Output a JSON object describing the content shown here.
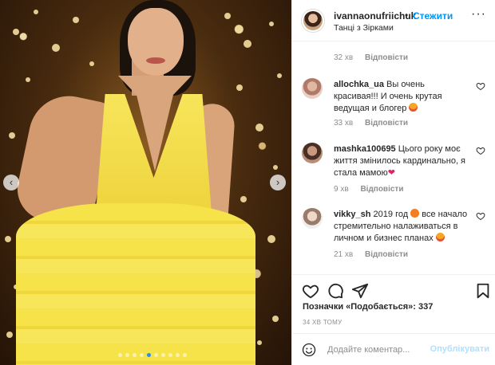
{
  "header": {
    "username": "ivannaonufriichuk",
    "separator": "•",
    "follow_label": "Стежити",
    "location": "Танці з Зірками",
    "more_icon": "more-horizontal-icon"
  },
  "comments": [
    {
      "meta_time": "32 хв",
      "reply_label": "Відповісти"
    },
    {
      "username": "allochka_ua",
      "text": "Вы очень красивая!!! И очень крутая ведущая и блогер",
      "emoji": "heart-eyes-emoji",
      "time": "33 хв",
      "reply_label": "Відповісти"
    },
    {
      "username": "mashka100695",
      "text": "Цього року моє життя змінилось кардинально, я стала мамою",
      "emoji": "red-heart-emoji",
      "time": "9 хв",
      "reply_label": "Відповісти"
    },
    {
      "username": "vikky_sh",
      "text_before": "2019 год",
      "text_after": "все начало стремительно налаживаться в личном и бизнес планах",
      "emoji_first": "fire-emoji",
      "emoji_second": "heart-eyes-emoji",
      "time": "21 хв",
      "reply_label": "Відповісти"
    }
  ],
  "actions": {
    "likes_text": "Позначки «Подобається»: 337",
    "timestamp": "34 ХВ ТОМУ"
  },
  "add_comment": {
    "placeholder": "Додайте коментар...",
    "publish_label": "Опублікувати"
  },
  "carousel": {
    "slide_count": 10,
    "active_index": 4
  },
  "colors": {
    "accent": "#0095f6",
    "publish_disabled": "#b2dffc",
    "dress": "#f6e34a",
    "active_dot": "#2b8cf0"
  }
}
